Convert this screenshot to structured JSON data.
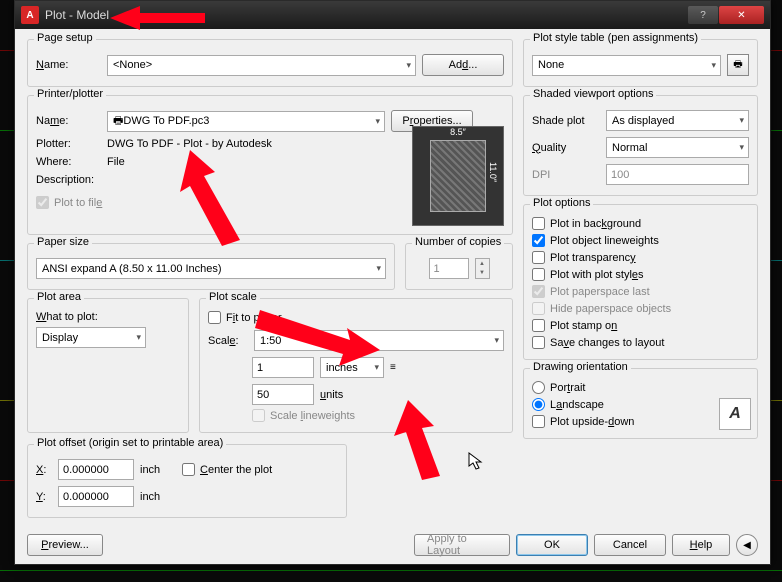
{
  "window": {
    "title": "Plot - Model"
  },
  "pageSetup": {
    "legend": "Page setup",
    "nameLabel": "Name:",
    "nameValue": "<None>",
    "addBtn": "Add..."
  },
  "printer": {
    "legend": "Printer/plotter",
    "nameLabel": "Name:",
    "nameValue": "DWG To PDF.pc3",
    "propsBtn": "Properties...",
    "plotterLabel": "Plotter:",
    "plotterValue": "DWG To PDF -           Plot - by Autodesk",
    "whereLabel": "Where:",
    "whereValue": "File",
    "descLabel": "Description:",
    "plotToFile": "Plot to file",
    "paperTop": "8.5″",
    "paperSide": "11.0″"
  },
  "paperSize": {
    "legend": "Paper size",
    "value": "ANSI expand A (8.50 x 11.00 Inches)"
  },
  "copies": {
    "legend": "Number of copies",
    "value": "1"
  },
  "plotArea": {
    "legend": "Plot area",
    "whatLabel": "What to plot:",
    "value": "Display"
  },
  "plotScale": {
    "legend": "Plot scale",
    "fit": "Fit to paper",
    "scaleLabel": "Scale:",
    "scaleValue": "1:50",
    "val1": "1",
    "unit1": "inches",
    "val2": "50",
    "unit2": "units",
    "scaleLw": "Scale lineweights"
  },
  "offset": {
    "legend": "Plot offset (origin set to printable area)",
    "xLabel": "X:",
    "xVal": "0.000000",
    "xUnit": "inch",
    "yLabel": "Y:",
    "yVal": "0.000000",
    "yUnit": "inch",
    "center": "Center the plot"
  },
  "styleTable": {
    "legend": "Plot style table (pen assignments)",
    "value": "None"
  },
  "shaded": {
    "legend": "Shaded viewport options",
    "shadeLabel": "Shade plot",
    "shadeValue": "As displayed",
    "qualityLabel": "Quality",
    "qualityValue": "Normal",
    "dpiLabel": "DPI",
    "dpiValue": "100"
  },
  "options": {
    "legend": "Plot options",
    "bg": "Plot in background",
    "lw": "Plot object lineweights",
    "trans": "Plot transparency",
    "styles": "Plot with plot styles",
    "pspace": "Plot paperspace last",
    "hide": "Hide paperspace objects",
    "stamp": "Plot stamp on",
    "save": "Save changes to layout"
  },
  "orient": {
    "legend": "Drawing orientation",
    "portrait": "Portrait",
    "landscape": "Landscape",
    "upside": "Plot upside-down"
  },
  "buttons": {
    "preview": "Preview...",
    "apply": "Apply to Layout",
    "ok": "OK",
    "cancel": "Cancel",
    "help": "Help"
  }
}
